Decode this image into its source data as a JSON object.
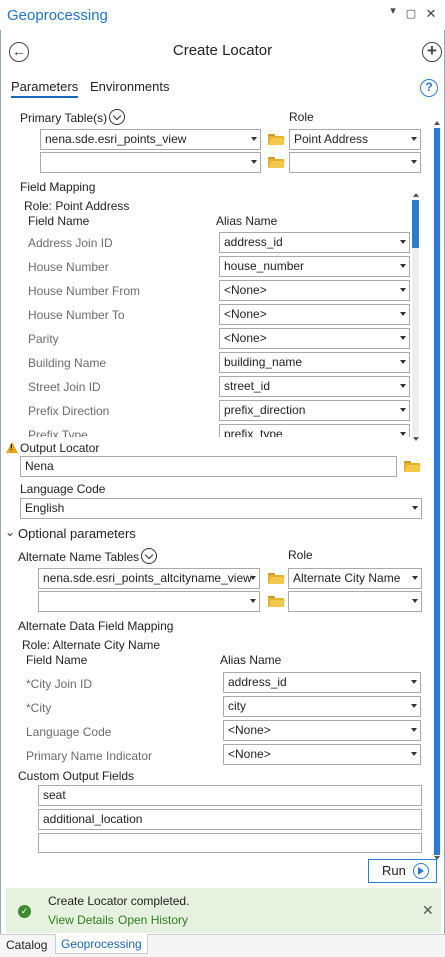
{
  "window": {
    "title": "Geoprocessing"
  },
  "tool": {
    "title": "Create Locator"
  },
  "tabs": [
    {
      "label": "Parameters"
    },
    {
      "label": "Environments"
    }
  ],
  "help_glyph": "?",
  "primary": {
    "label": "Primary Table(s)",
    "role_label": "Role",
    "rows": [
      {
        "table": "nena.sde.esri_points_view",
        "role": "Point Address"
      },
      {
        "table": "",
        "role": ""
      }
    ]
  },
  "field_mapping": {
    "label": "Field Mapping",
    "role_caption": "Role: Point Address",
    "col_field": "Field Name",
    "col_alias": "Alias Name",
    "rows": [
      {
        "field": "Address Join ID",
        "alias": "address_id"
      },
      {
        "field": "House Number",
        "alias": "house_number"
      },
      {
        "field": "House Number From",
        "alias": "<None>"
      },
      {
        "field": "House Number To",
        "alias": "<None>"
      },
      {
        "field": "Parity",
        "alias": "<None>"
      },
      {
        "field": "Building Name",
        "alias": "building_name"
      },
      {
        "field": "Street Join ID",
        "alias": "street_id"
      },
      {
        "field": "Prefix Direction",
        "alias": "prefix_direction"
      },
      {
        "field": "Prefix Type",
        "alias": "prefix_type"
      }
    ]
  },
  "output_locator": {
    "label": "Output Locator",
    "value": "Nena"
  },
  "language": {
    "label": "Language Code",
    "value": "English"
  },
  "optional": {
    "label": "Optional parameters"
  },
  "alternate": {
    "label": "Alternate Name Tables",
    "role_label": "Role",
    "rows": [
      {
        "table": "nena.sde.esri_points_altcityname_view",
        "role": "Alternate City Name"
      },
      {
        "table": "",
        "role": ""
      }
    ]
  },
  "alt_mapping": {
    "label": "Alternate Data Field Mapping",
    "role_caption": "Role: Alternate City Name",
    "col_field": "Field Name",
    "col_alias": "Alias Name",
    "rows": [
      {
        "field": "*City Join ID",
        "alias": "address_id"
      },
      {
        "field": "*City",
        "alias": "city"
      },
      {
        "field": "Language Code",
        "alias": "<None>"
      },
      {
        "field": "Primary Name Indicator",
        "alias": "<None>"
      }
    ]
  },
  "custom_fields": {
    "label": "Custom Output Fields",
    "values": [
      "seat",
      "additional_location",
      ""
    ]
  },
  "run": {
    "label": "Run"
  },
  "status": {
    "message": "Create Locator completed.",
    "view_details": "View Details",
    "open_history": "Open History"
  },
  "bottom_tabs": [
    {
      "label": "Catalog"
    },
    {
      "label": "Geoprocessing"
    }
  ],
  "colors": {
    "accent": "#2b7bd5",
    "success_bg": "#e7f1e0",
    "success_icon": "#3b8a2e",
    "warning": "#e8a31b"
  }
}
